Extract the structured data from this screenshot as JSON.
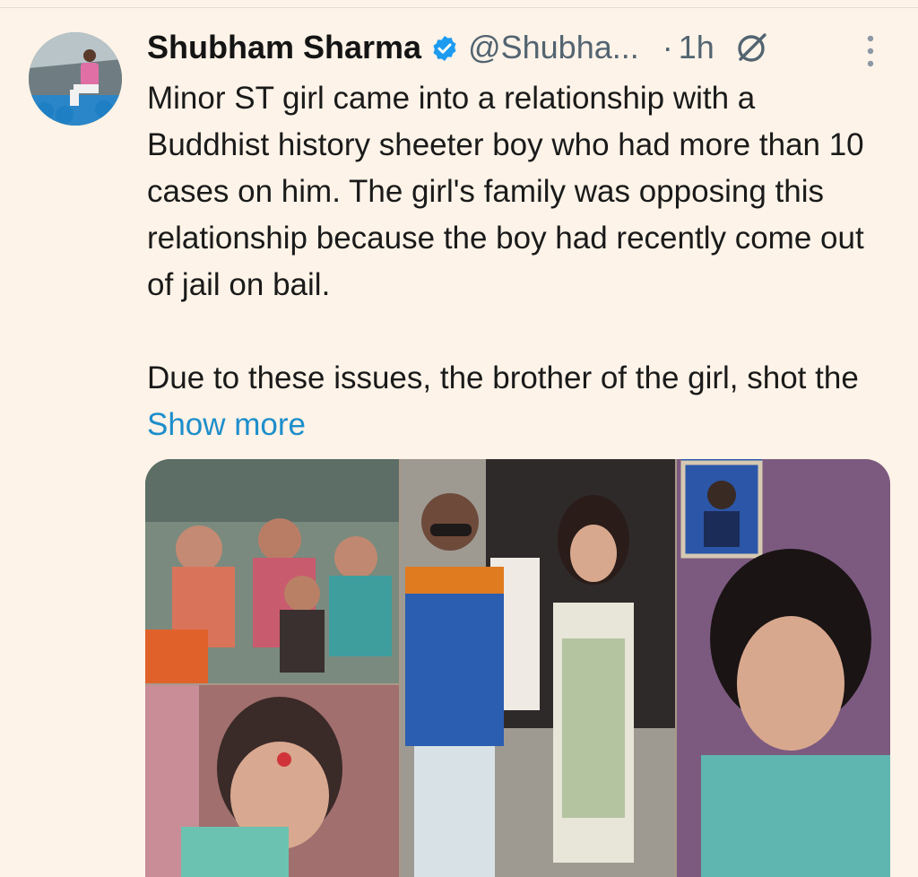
{
  "tweet": {
    "author_name": "Shubham Sharma",
    "handle": "@Shubha...",
    "separator": "·",
    "time": "1h",
    "body_paragraphs": [
      "Minor ST girl came into a relationship with a Buddhist history sheeter boy who had more than 10 cases on him. The girl's family was opposing this relationship because the boy had recently come out of jail on bail.",
      "Due to these issues, the brother of the girl, shot the"
    ],
    "show_more": "Show more"
  },
  "icons": {
    "avatar": "profile-photo",
    "verified": "verified-badge-icon",
    "grok": "grok-icon",
    "more": "more-vertical-icon"
  },
  "colors": {
    "background": "#fdf3e8",
    "link": "#1d8ecb",
    "verified": "#1d9bf0",
    "secondary_text": "#536471"
  }
}
